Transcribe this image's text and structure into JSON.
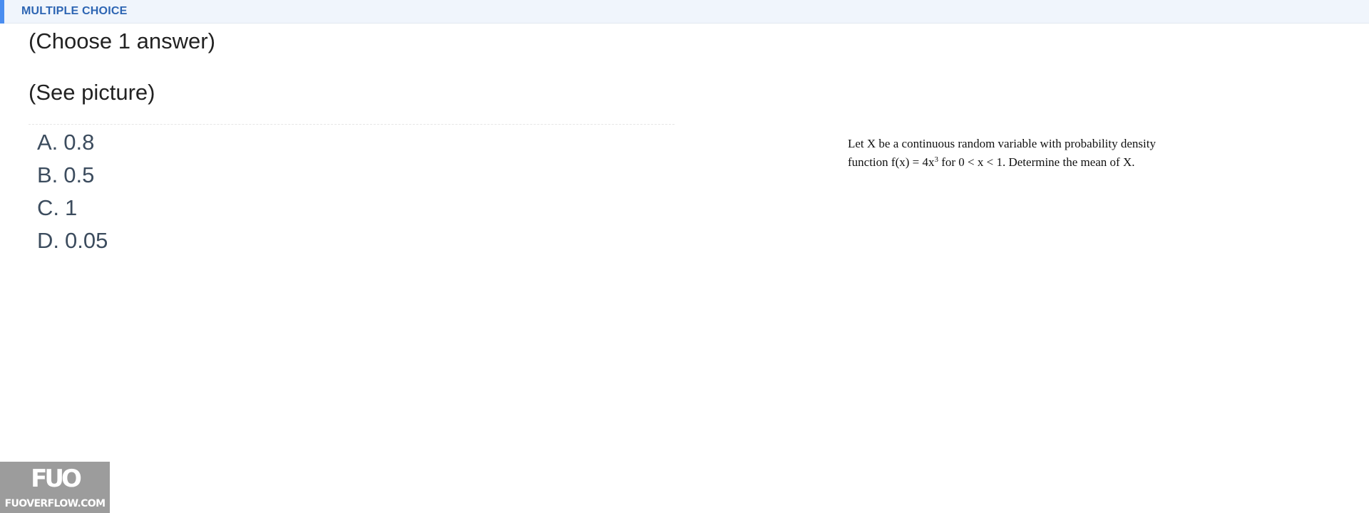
{
  "header": {
    "title": "MULTIPLE CHOICE"
  },
  "question": {
    "instruction": "(Choose 1 answer)",
    "prompt": "(See picture)"
  },
  "options": [
    {
      "letter": "A.",
      "text": "0.8"
    },
    {
      "letter": "B.",
      "text": "0.5"
    },
    {
      "letter": "C.",
      "text": "1"
    },
    {
      "letter": "D.",
      "text": "0.05"
    }
  ],
  "picture": {
    "text_before": "Let X be a continuous random variable with probability density function f(x) = 4x",
    "exponent": "3",
    "text_after": " for 0 < x < 1. Determine the mean of X."
  },
  "watermark": {
    "logo": "FUO",
    "site": "FUOVERFLOW.COM"
  },
  "colors": {
    "accent": "#4a8df0",
    "header_bg": "#f0f5fc",
    "header_text": "#2d65b3"
  }
}
